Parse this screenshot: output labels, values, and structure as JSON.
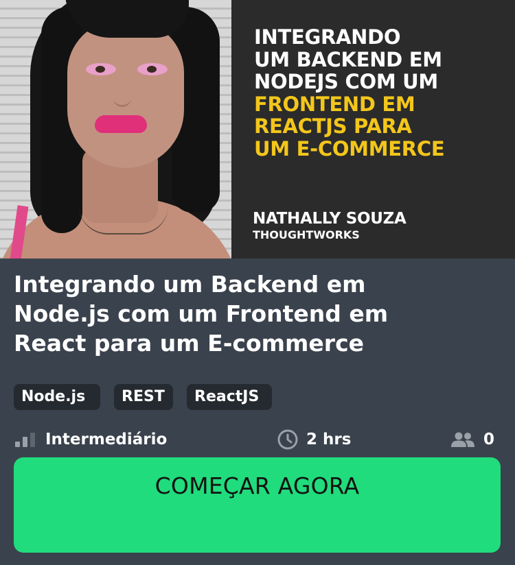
{
  "banner": {
    "photo_alt": "Foto de Nathally Souza",
    "headline_lines": [
      {
        "text": "INTEGRANDO",
        "color": "#ffffff"
      },
      {
        "text": "UM BACKEND EM",
        "color": "#ffffff"
      },
      {
        "text": "NODEJS COM UM",
        "color": "#ffffff"
      },
      {
        "text": "FRONTEND EM",
        "color": "#f3c61b"
      },
      {
        "text": "REACTJS PARA",
        "color": "#f3c61b"
      },
      {
        "text": "UM E-COMMERCE",
        "color": "#f3c61b"
      }
    ],
    "speaker_name": "NATHALLY SOUZA",
    "speaker_company": "THOUGHTWORKS"
  },
  "course": {
    "title_lines": [
      "Integrando um Backend em",
      "Node.js com um Frontend em",
      "React para um E-commerce"
    ],
    "tags": [
      "Node.js",
      "REST",
      "ReactJS"
    ],
    "level_icon": "signal-bars-icon",
    "level": "Intermediário",
    "duration_icon": "clock-icon",
    "duration": "2 hrs",
    "students_icon": "people-icon",
    "students": "0"
  },
  "cta": {
    "label": "COMEÇAR AGORA",
    "color": "#20dc7c"
  },
  "colors": {
    "background": "#3a424d",
    "banner_background": "#2b2b2b",
    "tag_background": "#252a30",
    "headline_accent": "#f3c61b"
  }
}
